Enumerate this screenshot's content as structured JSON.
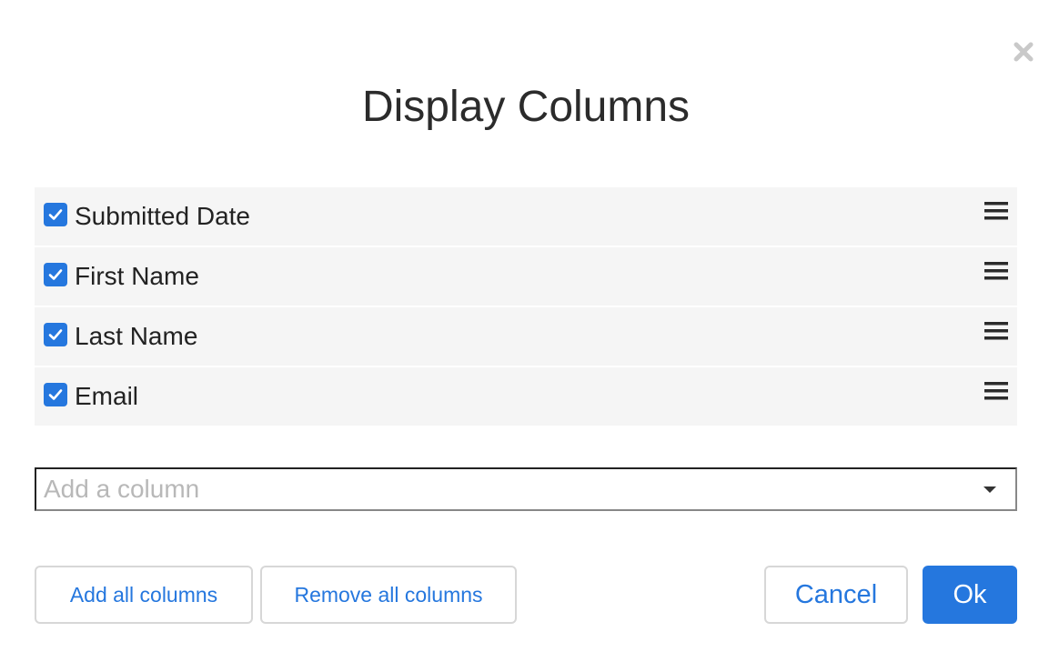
{
  "dialog": {
    "title": "Display Columns",
    "close_icon": "close-icon"
  },
  "columns": [
    {
      "label": "Submitted Date",
      "checked": true
    },
    {
      "label": "First Name",
      "checked": true
    },
    {
      "label": "Last Name",
      "checked": true
    },
    {
      "label": "Email",
      "checked": true
    }
  ],
  "add_column": {
    "placeholder": "Add a column"
  },
  "buttons": {
    "add_all": "Add all columns",
    "remove_all": "Remove all columns",
    "cancel": "Cancel",
    "ok": "Ok"
  },
  "colors": {
    "accent": "#2577de",
    "row_background": "#f5f5f5",
    "placeholder": "#b8b8b8"
  }
}
